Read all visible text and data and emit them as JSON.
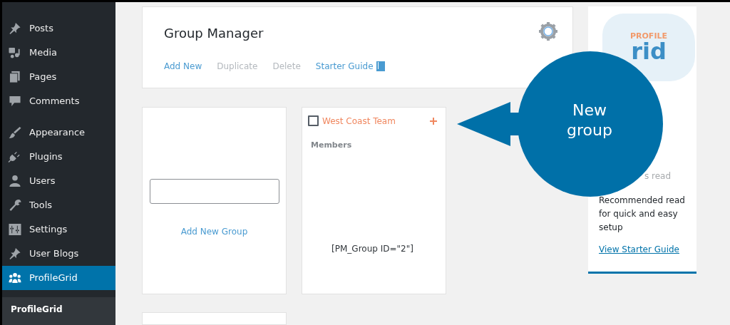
{
  "sidebar": {
    "groups": [
      [
        {
          "label": "Posts",
          "kind": "pin",
          "selected": false
        },
        {
          "label": "Media",
          "kind": "media",
          "selected": false
        },
        {
          "label": "Pages",
          "kind": "pages",
          "selected": false
        },
        {
          "label": "Comments",
          "kind": "comment",
          "selected": false
        }
      ],
      [
        {
          "label": "Appearance",
          "kind": "brush",
          "selected": false
        },
        {
          "label": "Plugins",
          "kind": "plug",
          "selected": false
        },
        {
          "label": "Users",
          "kind": "user",
          "selected": false
        },
        {
          "label": "Tools",
          "kind": "wrench",
          "selected": false
        },
        {
          "label": "Settings",
          "kind": "sliders",
          "selected": false
        },
        {
          "label": "User Blogs",
          "kind": "pin",
          "selected": false
        },
        {
          "label": "ProfileGrid",
          "kind": "people",
          "selected": true
        }
      ]
    ],
    "submenu": [
      {
        "label": "ProfileGrid",
        "selected": true
      }
    ]
  },
  "header": {
    "title": "Group Manager",
    "actions": [
      {
        "label": "Add New",
        "disabled": false,
        "kind": "plain"
      },
      {
        "label": "Duplicate",
        "disabled": true,
        "kind": "plain"
      },
      {
        "label": "Delete",
        "disabled": true,
        "kind": "plain"
      },
      {
        "label": "Starter Guide",
        "disabled": false,
        "kind": "guide"
      }
    ]
  },
  "new_group_card": {
    "button": "Add New Group"
  },
  "groups": [
    {
      "name": "West Coast Team",
      "checked": false,
      "members_label": "Members",
      "shortcode": "[PM_Group ID=\"2\"]"
    }
  ],
  "side_panel": {
    "logo": {
      "top": "PROFILE",
      "bottom": "rid"
    },
    "partial_heading": "s read",
    "description": "Recommended read for quick and easy setup",
    "link": "View Starter Guide"
  },
  "callout": {
    "text": "New group"
  }
}
